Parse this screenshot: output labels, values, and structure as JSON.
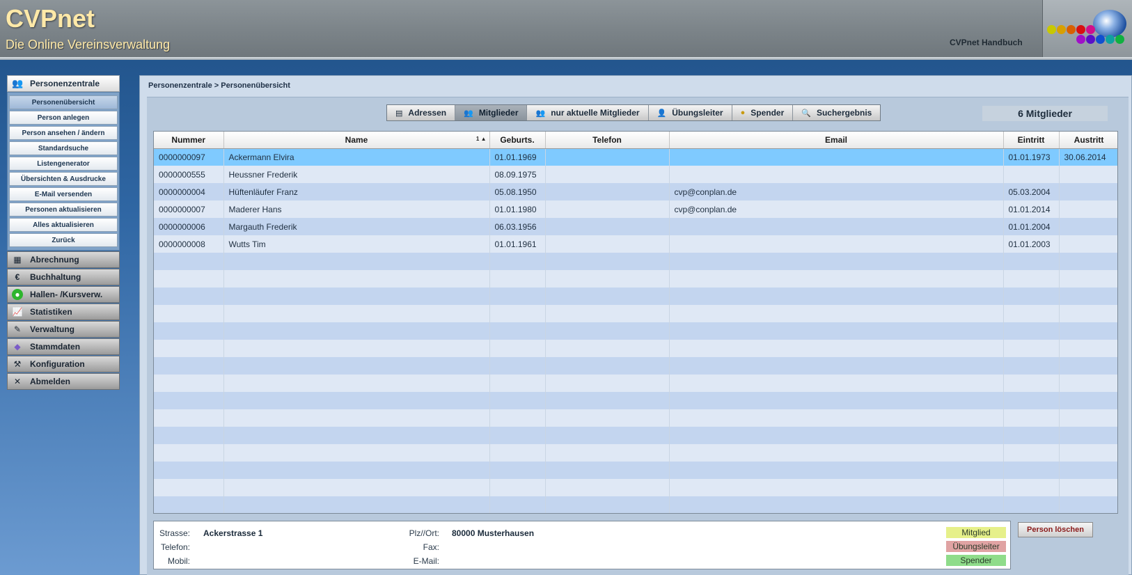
{
  "header": {
    "title": "CVPnet",
    "subtitle": "Die Online Vereinsverwaltung",
    "handbook_link": "CVPnet Handbuch"
  },
  "sidebar": {
    "main_section": "Personenzentrale",
    "subitems": [
      "Personenübersicht",
      "Person anlegen",
      "Person ansehen / ändern",
      "Standardsuche",
      "Listengenerator",
      "Übersichten & Ausdrucke",
      "E-Mail versenden",
      "Personen aktualisieren",
      "Alles aktualisieren",
      "Zurück"
    ],
    "groups": [
      "Abrechnung",
      "Buchhaltung",
      "Hallen- /Kursverw.",
      "Statistiken",
      "Verwaltung",
      "Stammdaten",
      "Konfiguration",
      "Abmelden"
    ]
  },
  "breadcrumb": "Personenzentrale > Personenübersicht",
  "tabs": [
    "Adressen",
    "Mitglieder",
    "nur aktuelle Mitglieder",
    "Übungsleiter",
    "Spender",
    "Suchergebnis"
  ],
  "member_count": "6 Mitglieder",
  "table": {
    "headers": [
      "Nummer",
      "Name",
      "Geburts.",
      "Telefon",
      "Email",
      "Eintritt",
      "Austritt"
    ],
    "sort_indicator": "1 ▲",
    "rows": [
      [
        "0000000097",
        "Ackermann Elvira",
        "01.01.1969",
        "",
        "",
        "01.01.1973",
        "30.06.2014"
      ],
      [
        "0000000555",
        "Heussner Frederik",
        "08.09.1975",
        "",
        "",
        "",
        ""
      ],
      [
        "0000000004",
        "Hüftenläufer Franz",
        "05.08.1950",
        "",
        "cvp@conplan.de",
        "05.03.2004",
        ""
      ],
      [
        "0000000007",
        "Maderer Hans",
        "01.01.1980",
        "",
        "cvp@conplan.de",
        "01.01.2014",
        ""
      ],
      [
        "0000000006",
        "Margauth Frederik",
        "06.03.1956",
        "",
        "",
        "01.01.2004",
        ""
      ],
      [
        "0000000008",
        "Wutts Tim",
        "01.01.1961",
        "",
        "",
        "01.01.2003",
        ""
      ]
    ]
  },
  "details": {
    "strasse_label": "Strasse:",
    "strasse_value": "Ackerstrasse 1",
    "telefon_label": "Telefon:",
    "mobil_label": "Mobil:",
    "plzort_label": "Plz//Ort:",
    "plzort_value": "80000 Musterhausen",
    "fax_label": "Fax:",
    "email_label": "E-Mail:"
  },
  "legend": {
    "mitglied": "Mitglied",
    "uebungsleiter": "Übungsleiter",
    "spender": "Spender",
    "colors": {
      "mitglied": "#e6f08a",
      "uebungsleiter": "#e0a3a3",
      "spender": "#8fdc8a"
    }
  },
  "delete_button": "Person löschen"
}
